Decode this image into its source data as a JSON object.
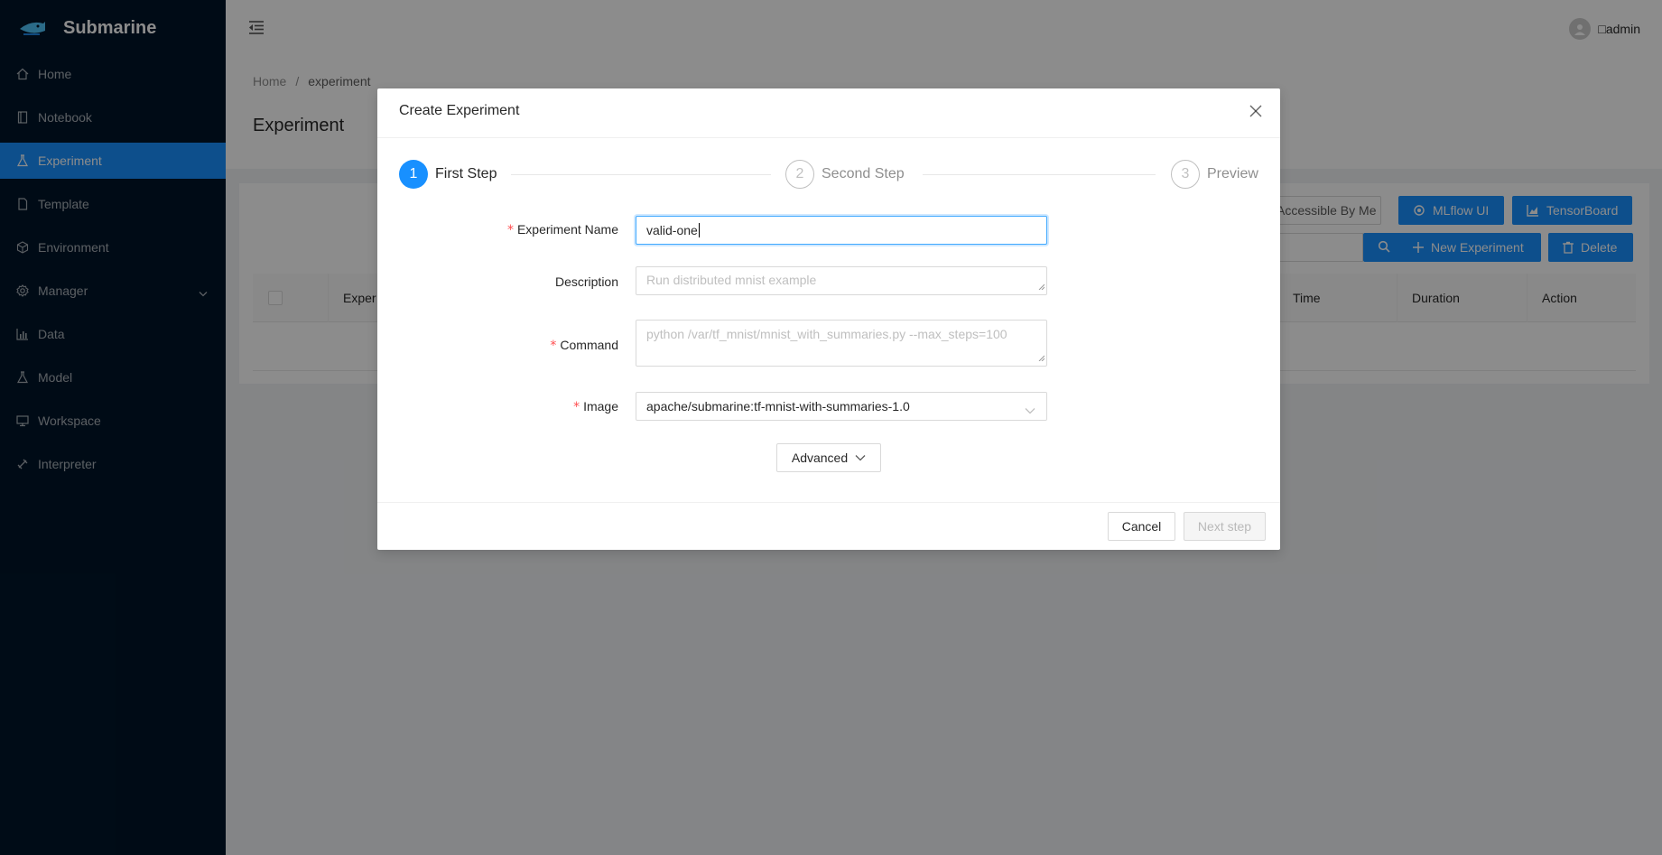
{
  "app": {
    "title": "Submarine"
  },
  "sidebar": {
    "items": [
      {
        "label": "Home",
        "icon": "home-icon"
      },
      {
        "label": "Notebook",
        "icon": "book-icon"
      },
      {
        "label": "Experiment",
        "icon": "experiment-icon",
        "active": true
      },
      {
        "label": "Template",
        "icon": "file-icon"
      },
      {
        "label": "Environment",
        "icon": "codesandbox-icon"
      },
      {
        "label": "Manager",
        "icon": "settings-icon"
      },
      {
        "label": "Data",
        "icon": "bar-chart-icon"
      },
      {
        "label": "Model",
        "icon": "experiment-icon"
      },
      {
        "label": "Workspace",
        "icon": "desktop-icon"
      },
      {
        "label": "Interpreter",
        "icon": "api-icon"
      }
    ]
  },
  "header": {
    "user": "admin",
    "user_prefix": "□"
  },
  "page": {
    "breadcrumb": [
      "Home",
      "experiment"
    ],
    "breadcrumb_sep": "/",
    "title": "Experiment"
  },
  "toolbar": {
    "accessible_label": "Accessible By Me",
    "mlflow_label": "MLflow UI",
    "tensorboard_label": "TensorBoard",
    "new_label": "New Experiment",
    "delete_label": "Delete"
  },
  "table": {
    "columns": [
      "Exper",
      "Time",
      "Duration",
      "Action"
    ]
  },
  "modal": {
    "title": "Create Experiment",
    "steps": [
      {
        "num": "1",
        "title": "First Step",
        "status": "active"
      },
      {
        "num": "2",
        "title": "Second Step",
        "status": "wait"
      },
      {
        "num": "3",
        "title": "Preview",
        "status": "wait"
      }
    ],
    "form": {
      "name_label": "Experiment Name",
      "name_value": "valid-one",
      "desc_label": "Description",
      "desc_placeholder": "Run distributed mnist example",
      "command_label": "Command",
      "command_placeholder": "python /var/tf_mnist/mnist_with_summaries.py --max_steps=100",
      "image_label": "Image",
      "image_value": "apache/submarine:tf-mnist-with-summaries-1.0",
      "required_mark": "*"
    },
    "advanced_label": "Advanced",
    "cancel_label": "Cancel",
    "next_label": "Next step"
  },
  "colors": {
    "primary": "#1890ff",
    "sidebar": "#001529",
    "required": "#ff4d4f"
  }
}
